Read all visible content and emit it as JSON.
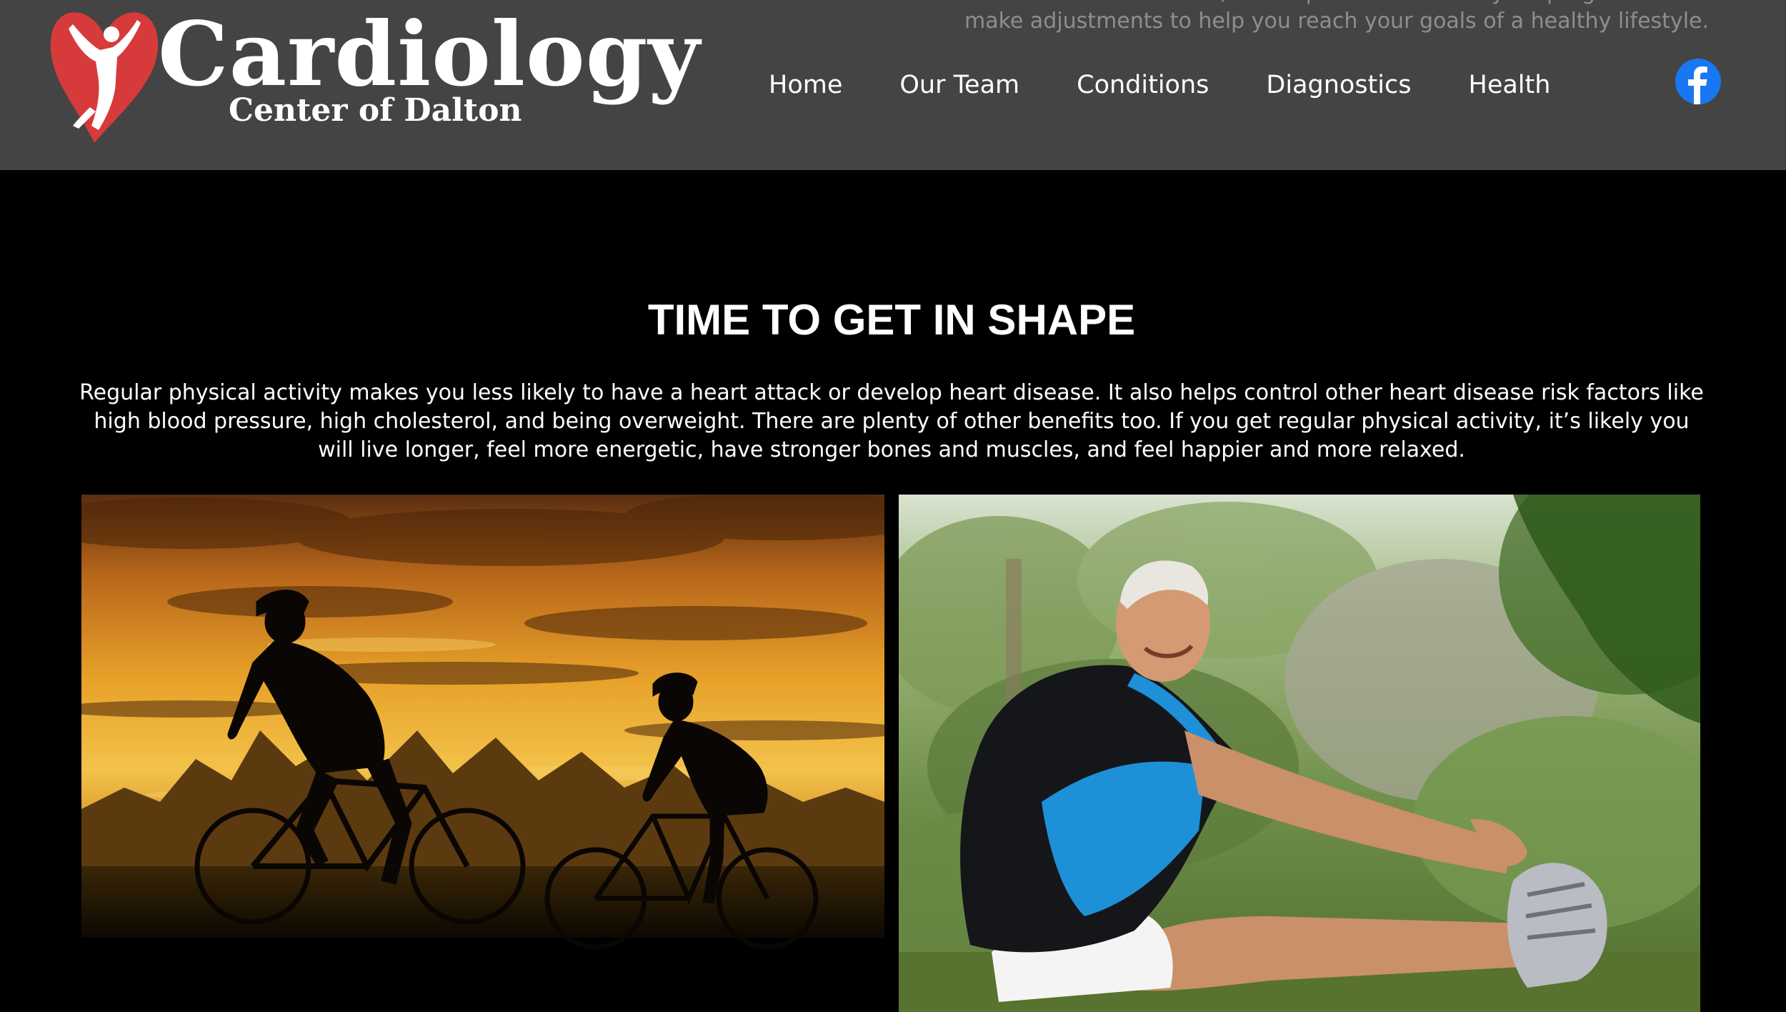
{
  "brand": {
    "title": "Cardiology",
    "subtitle": "Center of Dalton",
    "colors": {
      "header_bg": "#444444",
      "heart_red": "#d63a3a",
      "page_bg": "#000000",
      "facebook_blue": "#1877f2"
    }
  },
  "header": {
    "background_text": "increase. Once a month, it is important evaluate your progress and make adjustments to help you reach your goals of a healthy lifestyle.",
    "nav": [
      {
        "label": "Home"
      },
      {
        "label": "Our Team"
      },
      {
        "label": "Conditions"
      },
      {
        "label": "Diagnostics"
      },
      {
        "label": "Health"
      }
    ],
    "social_icon": "facebook-icon"
  },
  "main": {
    "title": "TIME TO GET IN SHAPE",
    "intro": "Regular physical activity makes you less likely to have a heart attack or develop heart disease. It also helps control other heart disease risk factors like high blood pressure, high cholesterol, and being overweight. There are plenty of other benefits too. If you get regular physical activity, it’s likely you will live longer, feel more energetic, have stronger bones and muscles, and feel happier and more relaxed."
  }
}
